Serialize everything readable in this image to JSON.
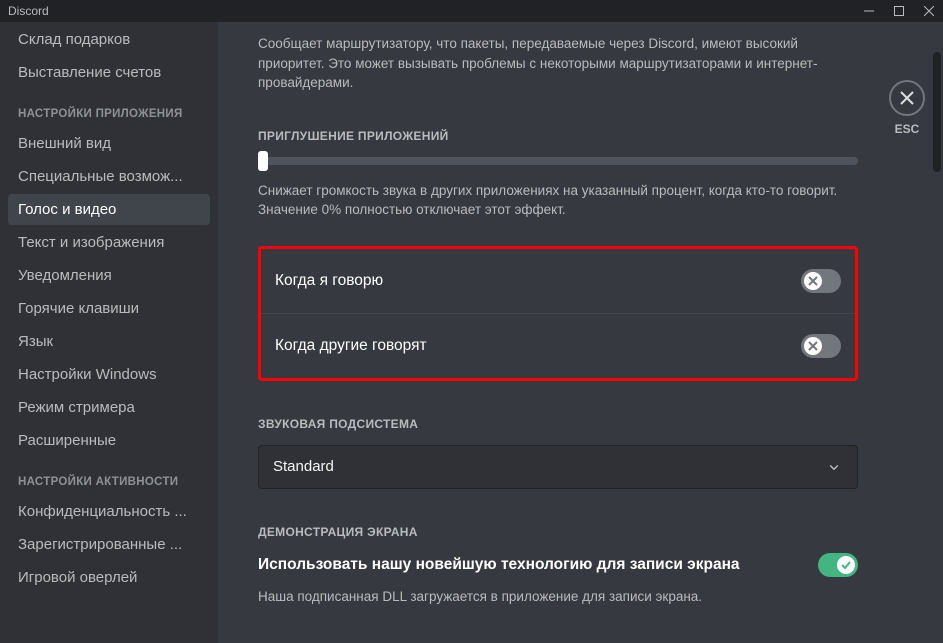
{
  "titlebar": {
    "app_name": "Discord"
  },
  "close": {
    "esc_label": "ESC"
  },
  "sidebar": {
    "items_top": [
      {
        "label": "Склад подарков"
      },
      {
        "label": "Выставление счетов"
      }
    ],
    "header_app": "НАСТРОЙКИ ПРИЛОЖЕНИЯ",
    "items_app": [
      {
        "label": "Внешний вид"
      },
      {
        "label": "Специальные возмож..."
      },
      {
        "label": "Голос и видео",
        "selected": true
      },
      {
        "label": "Текст и изображения"
      },
      {
        "label": "Уведомления"
      },
      {
        "label": "Горячие клавиши"
      },
      {
        "label": "Язык"
      },
      {
        "label": "Настройки Windows"
      },
      {
        "label": "Режим стримера"
      },
      {
        "label": "Расширенные"
      }
    ],
    "header_activity": "НАСТРОЙКИ АКТИВНОСТИ",
    "items_activity": [
      {
        "label": "Конфиденциальность ..."
      },
      {
        "label": "Зарегистрированные ..."
      },
      {
        "label": "Игровой оверлей"
      }
    ]
  },
  "content": {
    "qos_desc": "Сообщает маршрутизатору, что пакеты, передаваемые через Discord, имеют высокий приоритет. Это может вызывать проблемы с некоторыми маршрутизаторами и интернет-провайдерами.",
    "attenuation_header": "ПРИГЛУШЕНИЕ ПРИЛОЖЕНИЙ",
    "attenuation_desc": "Снижает громкость звука в других приложениях на указанный процент, когда кто-то говорит. Значение 0% полностью отключает этот эффект.",
    "toggle_i_speak": "Когда я говорю",
    "toggle_others_speak": "Когда другие говорят",
    "subsystem_header": "ЗВУКОВАЯ ПОДСИСТЕМА",
    "subsystem_value": "Standard",
    "screenshare_header": "ДЕМОНСТРАЦИЯ ЭКРАНА",
    "screenshare_title": "Использовать нашу новейшую технологию для записи экрана",
    "screenshare_desc": "Наша подписанная DLL загружается в приложение для записи экрана."
  }
}
